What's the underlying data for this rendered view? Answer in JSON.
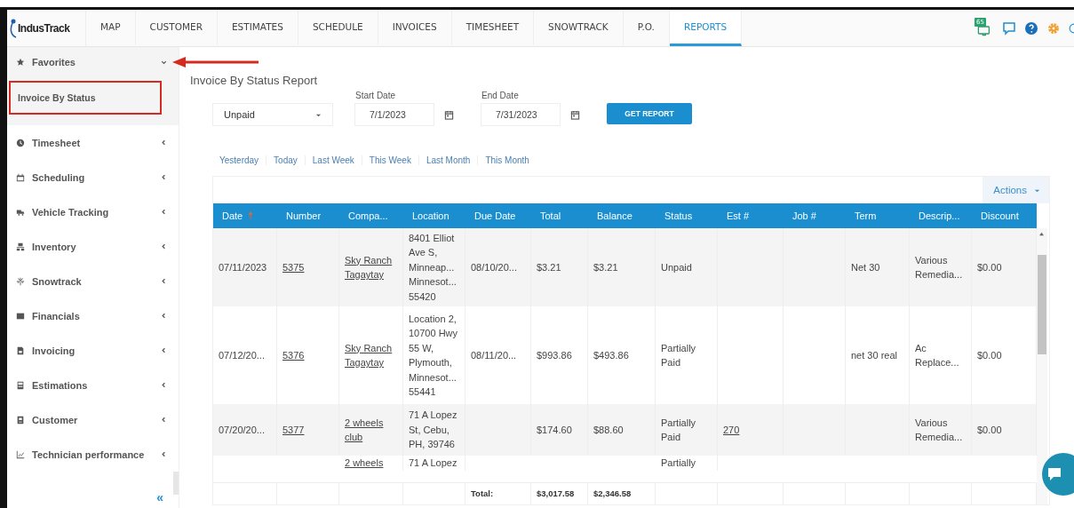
{
  "app": {
    "logo": "IndusTrack"
  },
  "nav": [
    {
      "label": "MAP",
      "selected": false
    },
    {
      "label": "CUSTOMER",
      "selected": false
    },
    {
      "label": "ESTIMATES",
      "selected": false
    },
    {
      "label": "SCHEDULE",
      "selected": false
    },
    {
      "label": "INVOICES",
      "selected": false
    },
    {
      "label": "TIMESHEET",
      "selected": false
    },
    {
      "label": "SNOWTRACK",
      "selected": false
    },
    {
      "label": "P.O.",
      "selected": false
    },
    {
      "label": "REPORTS",
      "selected": true
    }
  ],
  "notification_badge": "65",
  "sidebar": {
    "items": [
      {
        "label": "Favorites",
        "expanded": true,
        "children": [
          {
            "label": "Invoice By Status",
            "highlighted": true
          }
        ]
      },
      {
        "label": "Timesheet",
        "expanded": false
      },
      {
        "label": "Scheduling",
        "expanded": false
      },
      {
        "label": "Vehicle Tracking",
        "expanded": false
      },
      {
        "label": "Inventory",
        "expanded": false
      },
      {
        "label": "Snowtrack",
        "expanded": false
      },
      {
        "label": "Financials",
        "expanded": false
      },
      {
        "label": "Invoicing",
        "expanded": false
      },
      {
        "label": "Estimations",
        "expanded": false
      },
      {
        "label": "Customer",
        "expanded": false
      },
      {
        "label": "Technician performance",
        "expanded": false
      }
    ],
    "collapse": "«"
  },
  "report": {
    "title": "Invoice By Status Report",
    "status_select": {
      "value": "Unpaid"
    },
    "start_date": {
      "label": "Start Date",
      "value": "7/1/2023"
    },
    "end_date": {
      "label": "End Date",
      "value": "7/31/2023"
    },
    "submit": "GET REPORT",
    "quick_ranges": [
      "Yesterday",
      "Today",
      "Last Week",
      "This Week",
      "Last Month",
      "This Month"
    ],
    "actions": "Actions"
  },
  "table": {
    "columns": [
      {
        "label": "Date",
        "sorted": true
      },
      {
        "label": "Number",
        "sorted": false
      },
      {
        "label": "Compa...",
        "sorted": false
      },
      {
        "label": "Location",
        "sorted": false
      },
      {
        "label": "Due Date",
        "sorted": false
      },
      {
        "label": "Total",
        "sorted": false
      },
      {
        "label": "Balance",
        "sorted": false
      },
      {
        "label": "Status",
        "sorted": false
      },
      {
        "label": "Est #",
        "sorted": false
      },
      {
        "label": "Job #",
        "sorted": false
      },
      {
        "label": "Term",
        "sorted": false
      },
      {
        "label": "Descrip...",
        "sorted": false
      },
      {
        "label": "Discount",
        "sorted": false
      }
    ],
    "rows": [
      {
        "cells": [
          "07/11/2023",
          {
            "kind": "link",
            "text": "5375"
          },
          {
            "kind": "link",
            "text": "Sky Ranch Tagaytay"
          },
          "8401 Elliot Ave S, Minneap... Minnesot... 55420",
          "08/10/20...",
          "$3.21",
          "$3.21",
          "Unpaid",
          "",
          "",
          "Net 30",
          "Various Remedia...",
          "$0.00"
        ]
      },
      {
        "cells": [
          "07/12/20...",
          {
            "kind": "link",
            "text": "5376"
          },
          {
            "kind": "link",
            "text": "Sky Ranch Tagaytay"
          },
          "Location 2, 10700 Hwy 55 W, Plymouth, Minnesot... 55441",
          "08/11/20...",
          "$993.86",
          "$493.86",
          "Partially Paid",
          "",
          "",
          "net 30 real",
          "Ac Replace...",
          "$0.00"
        ]
      },
      {
        "cells": [
          "07/20/20...",
          {
            "kind": "link",
            "text": "5377"
          },
          {
            "kind": "link",
            "text": "2 wheels club"
          },
          "71 A Lopez St, Cebu, PH, 39746",
          "",
          "$174.60",
          "$88.60",
          "Partially Paid",
          {
            "kind": "link",
            "text": "270"
          },
          "",
          "",
          "Various Remedia...",
          "$0.00"
        ]
      },
      {
        "cells": [
          "",
          "",
          {
            "kind": "link",
            "text": "2 wheels"
          },
          "71 A Lopez",
          "",
          "",
          "",
          "Partially",
          "",
          "",
          "",
          "",
          ""
        ]
      }
    ],
    "footer": {
      "label": "Total:",
      "total": "$3,017.58",
      "balance": "$2,346.58"
    }
  }
}
